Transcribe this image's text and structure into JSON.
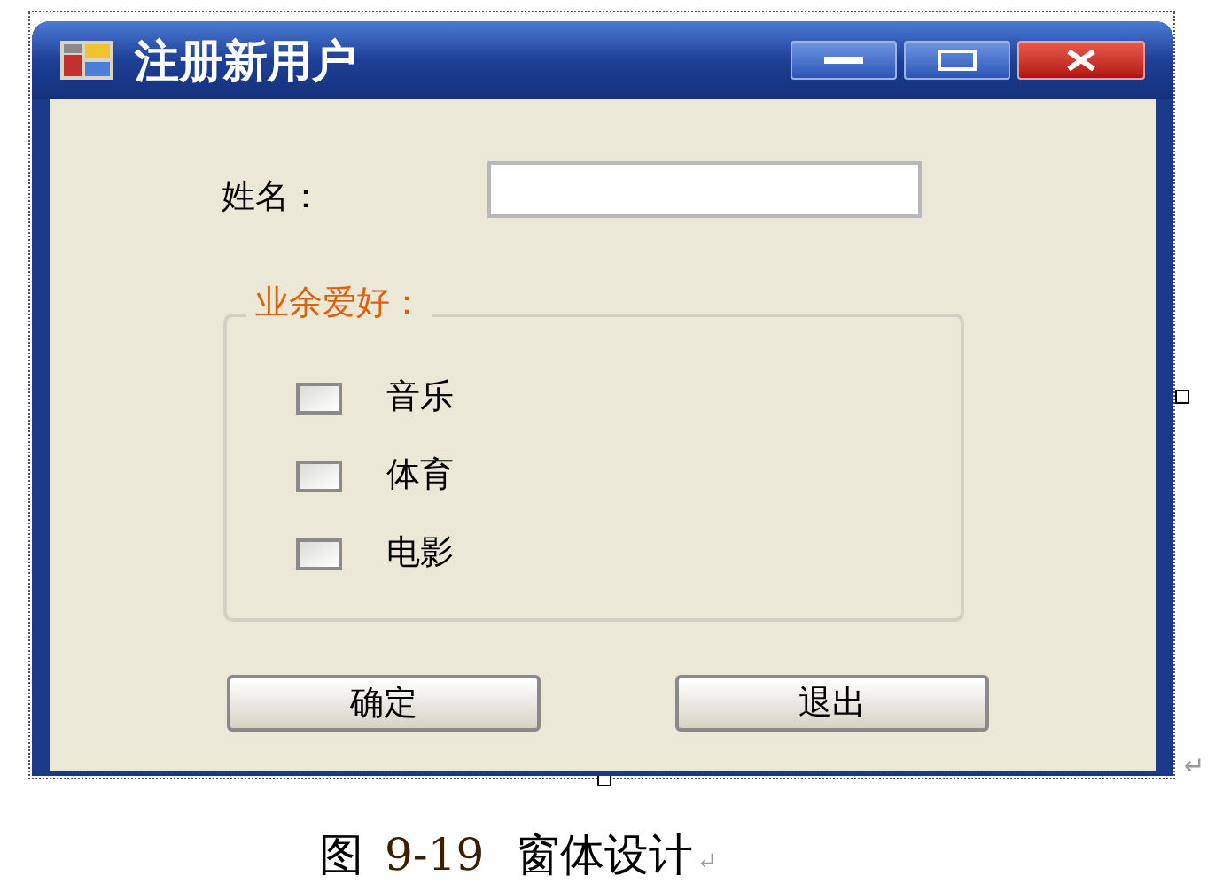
{
  "window": {
    "title": "注册新用户"
  },
  "name_field": {
    "label": "姓名："
  },
  "hobbies": {
    "legend": "业余爱好：",
    "options": [
      {
        "label": "音乐",
        "checked": false
      },
      {
        "label": "体育",
        "checked": false
      },
      {
        "label": "电影",
        "checked": false
      }
    ]
  },
  "buttons": [
    "确定",
    "退出"
  ],
  "caption": {
    "figure": "图",
    "number": "9-19",
    "text": "窗体设计",
    "mark": "↵"
  },
  "side_mark": "↵"
}
